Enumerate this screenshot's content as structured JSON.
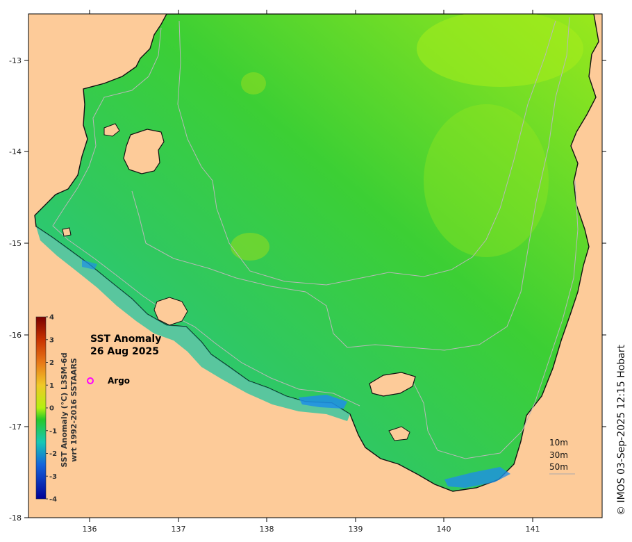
{
  "map": {
    "title_line1": "SST Anomaly",
    "title_line2": "26 Aug 2025",
    "credit": "© IMOS 03-Sep-2025 12:15 Hobart",
    "legend": {
      "marker_color": "#ff00ff",
      "label": "Argo"
    },
    "depth_labels": [
      "10m",
      "30m",
      "50m"
    ],
    "colorbar": {
      "title_line1": "SST Anomaly (°C) L3SM-6d",
      "title_line2": "wrt 1992-2016 SSTAARS",
      "ticks": [
        "4",
        "3",
        "2",
        "1",
        "0",
        "-1",
        "-2",
        "-3",
        "-4"
      ],
      "colors": [
        "#7a0000",
        "#c83200",
        "#e87818",
        "#f0c828",
        "#b4f010",
        "#28c828",
        "#18c8b4",
        "#1464dc",
        "#000096"
      ]
    },
    "axes": {
      "x_ticks": [
        "136",
        "137",
        "138",
        "139",
        "140",
        "141"
      ],
      "y_ticks": [
        "-13",
        "-14",
        "-15",
        "-16",
        "-17",
        "-18"
      ]
    },
    "colors": {
      "land": "#fdcb99",
      "water_main": "#3ec83e",
      "water_light": "#8ae01e",
      "water_shelf": "#22c4a0",
      "water_cold": "#1e90e0"
    }
  }
}
